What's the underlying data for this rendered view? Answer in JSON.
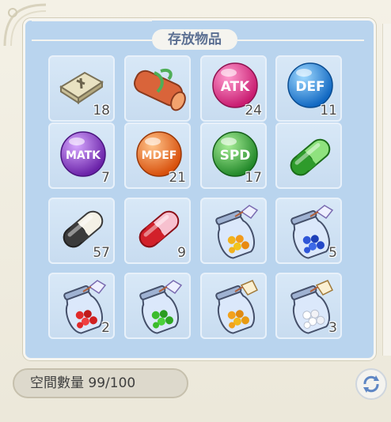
{
  "window": {
    "title": "存放物品"
  },
  "slots": [
    {
      "item": "stone-tablet-icon",
      "count": "18"
    },
    {
      "item": "scroll-icon",
      "count": ""
    },
    {
      "item": "atk-orb-icon",
      "label": "ATK",
      "color": "#e6378a",
      "count": "24"
    },
    {
      "item": "def-orb-icon",
      "label": "DEF",
      "color": "#1f8ee6",
      "count": "11"
    },
    {
      "item": "matk-orb-icon",
      "label": "MATK",
      "color": "#8a3dc8",
      "count": "7"
    },
    {
      "item": "mdef-orb-icon",
      "label": "MDEF",
      "color": "#f06a16",
      "count": "21"
    },
    {
      "item": "spd-orb-icon",
      "label": "SPD",
      "color": "#37a835",
      "count": "17"
    },
    {
      "item": "green-capsule-icon",
      "color": "#2e9b2b",
      "count": ""
    },
    {
      "item": "black-capsule-icon",
      "color": "#3b3b3b",
      "count": "57"
    },
    {
      "item": "red-capsule-icon",
      "color": "#d2202a",
      "count": "9"
    },
    {
      "item": "yellow-candy-jar-icon",
      "color": "#f2b21c",
      "count": ""
    },
    {
      "item": "blue-candy-jar-icon",
      "color": "#2f56d8",
      "count": "5"
    },
    {
      "item": "red-candy-jar-icon",
      "color": "#e02a2a",
      "count": "2"
    },
    {
      "item": "green-candy-jar-icon",
      "color": "#3cbc2d",
      "count": ""
    },
    {
      "item": "yellow-candy-jar-icon",
      "color": "#f2a11c",
      "count": ""
    },
    {
      "item": "white-candy-jar-icon",
      "color": "#f2f2f6",
      "count": "3"
    }
  ],
  "capacity": {
    "label": "空間數量 99/100"
  },
  "refresh_button": {
    "icon": "refresh-icon"
  }
}
